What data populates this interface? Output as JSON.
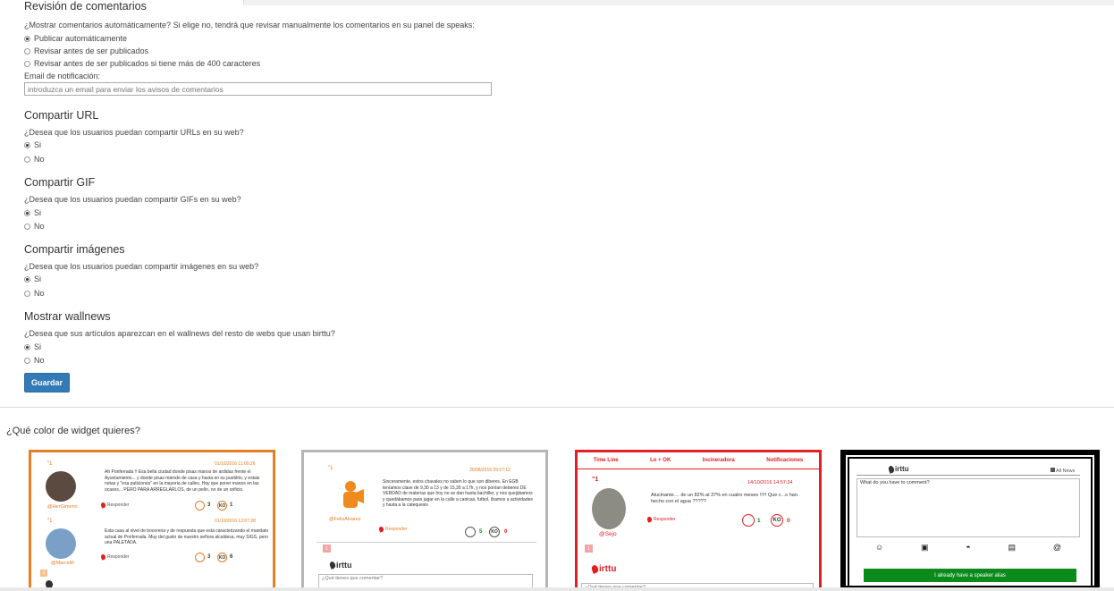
{
  "form": {
    "review": {
      "title": "Revisión de comentarios",
      "question": "¿Mostrar comentarios automáticamente? Si elige no, tendrá que revisar manualmente los comentarios en su panel de speaks:",
      "options": [
        "Publicar automáticamente",
        "Revisar antes de ser publicados",
        "Revisar antes de ser publicados si tiene más de 400 caracteres"
      ],
      "selected": 0,
      "email_label": "Email de notificación:",
      "email_placeholder": "introduzca un email para enviar los avisos de comentarios"
    },
    "share_url": {
      "title": "Compartir URL",
      "question": "¿Desea que los usuarios puedan compartir URLs en su web?",
      "yes": "Si",
      "no": "No",
      "selected": "yes"
    },
    "share_gif": {
      "title": "Compartir GIF",
      "question": "¿Desea que los usuarios puedan compartir GIFs en su web?",
      "yes": "Si",
      "no": "No",
      "selected": "yes"
    },
    "share_images": {
      "title": "Compartir imágenes",
      "question": "¿Desea que los usuarios puedan compartir imágenes en su web?",
      "yes": "Si",
      "no": "No",
      "selected": "yes"
    },
    "wallnews": {
      "title": "Mostrar wallnews",
      "question": "¿Desea que sus artículos aparezcan en el wallnews del resto de webs que usan birttu?",
      "yes": "Si",
      "no": "No",
      "selected": "yes"
    },
    "save_label": "Guardar"
  },
  "colors": {
    "button": "#337ab7",
    "orange": "#e67e22",
    "gray": "#b5b5b5",
    "red": "#e31e24",
    "black": "#000000",
    "green": "#0a8a1a"
  },
  "widget_question": "¿Qué color de widget quieres?",
  "widgets": {
    "orange": {
      "c1": {
        "num": "\"1",
        "date": "01/10/2016 11:09:26",
        "handle": "@HerGimeno",
        "text": "Ah Ponferrada !! Esa bella ciudad donde pisas manos de ardidas frente el Ayuntamiento... y donde pisas miendo de casa y hasta en su pueblito, y estais notas y \"esa puticiones\" en la mayoría de calles. Hay que poner manos en las ocasos... PERO PARA ARREGLARLOS, de un pelín, no de un orificio.",
        "reply": "Responder",
        "ok": "3",
        "ko": "1"
      },
      "c2": {
        "num": "\"1",
        "date": "01/10/2016 12:07:28",
        "handle": "@Marcelill",
        "text": "Esta casa al nivel de bocereria y de respuesta que está caracterizando el mandato actual de Ponferrada. Muy del gusto de nuestro señora alcaldesa, muy SIGS, pero una PALETADA.",
        "reply": "Responder",
        "ok": "3",
        "ko": "6"
      },
      "square": "1"
    },
    "gray": {
      "num": "\"1",
      "date": "30/08/2016 09:57:12",
      "handle": "@FelixAlvarez",
      "text": "Sinceramente, estos chavales no saben lo que son diberes. En EGB teníamos clase de 9,30 a 13 y de 15,30 a 17h, y nos ponían deberes DE VERDAD de materias que hoy no se dan hasta bachiller, y nos quejábamos y quedábamos para jugar en la calle a canicas, futbol, íbamos a actividades y hasta a la catequesis",
      "reply": "Responder",
      "ok": "5",
      "ko": "0",
      "square": "1",
      "logo": "irttu",
      "placeholder": "¿Qué tienes que comentar?"
    },
    "red": {
      "tabs": [
        "Time Line",
        "Lo + OK",
        "Incineradora",
        "Notificaciones"
      ],
      "num": "\"1",
      "date": "14/10/2016 14:57:34",
      "handle": "@Sejo",
      "text": "Alucinante.... de un 82% al 37% en cuatro meses !!!!! Que c...o han hecho con el agua ?????",
      "reply": "Responder",
      "ok": "1",
      "ko": "0",
      "square": "1",
      "logo": "irttu",
      "placeholder": "¿Qué tienes que comentar?"
    },
    "black": {
      "logo": "irttu",
      "news": "All News",
      "placeholder": "What do you have to comment?",
      "icons": [
        "smiley-icon",
        "camera-icon",
        "gif-icon",
        "image-icon",
        "at-icon"
      ],
      "at_glyph": "@",
      "button": "I already have a speaker alias"
    }
  }
}
